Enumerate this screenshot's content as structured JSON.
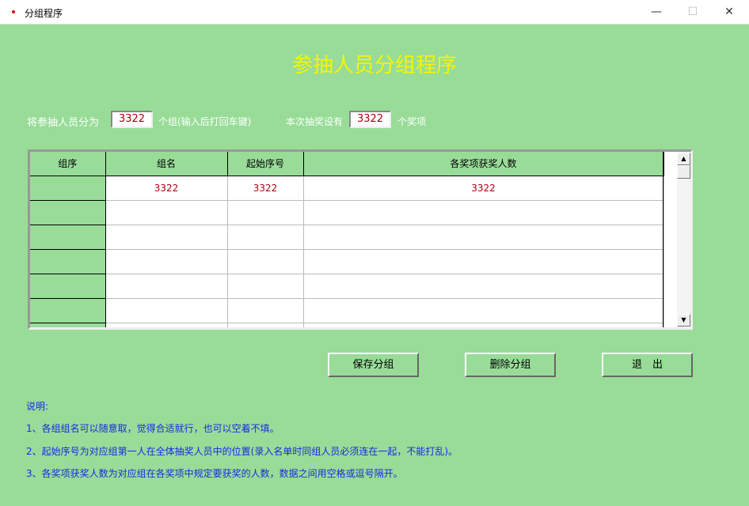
{
  "window": {
    "title": "分组程序",
    "minimize": "—",
    "maximize": "☐",
    "close": "✕"
  },
  "heading": "参抽人员分组程序",
  "form": {
    "groups_label": "将参抽人员分为",
    "groups_value": "3322",
    "groups_suffix": "个组(输入后打回车键)",
    "prizes_label": "本次抽奖设有",
    "prizes_value": "3322",
    "prizes_suffix": "个奖项"
  },
  "grid": {
    "headers": [
      "组序",
      "组名",
      "起始序号",
      "各奖项获奖人数"
    ],
    "rows": [
      [
        "",
        "3322",
        "3322",
        "3322"
      ],
      [
        "",
        "",
        "",
        ""
      ],
      [
        "",
        "",
        "",
        ""
      ],
      [
        "",
        "",
        "",
        ""
      ],
      [
        "",
        "",
        "",
        ""
      ],
      [
        "",
        "",
        "",
        ""
      ],
      [
        "",
        "",
        "",
        ""
      ]
    ]
  },
  "buttons": {
    "save": "保存分组",
    "delete": "删除分组",
    "exit": "退　出"
  },
  "notes": {
    "title": "说明:",
    "items": [
      "1、各组组名可以随意取，觉得合适就行，也可以空着不填。",
      "2、起始序号为对应组第一人在全体抽奖人员中的位置(录入名单时同组人员必须连在一起，不能打乱)。",
      "3、各奖项获奖人数为对应组在各奖项中规定要获奖的人数，数据之间用空格或逗号隔开。"
    ]
  }
}
